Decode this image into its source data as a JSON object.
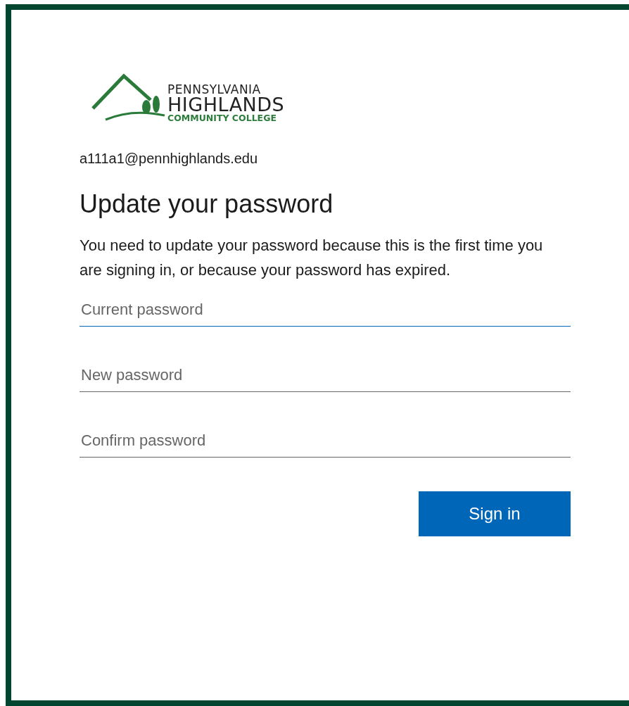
{
  "logo": {
    "line_1": "PENNSYLVANIA",
    "line_2": "HIGHLANDS",
    "line_3": "COMMUNITY COLLEGE"
  },
  "account": "a111a1@pennhighlands.edu",
  "title": "Update your password",
  "description": "You need to update your password because this is the first time you are signing in, or because your password has expired.",
  "fields": [
    {
      "placeholder": "Current password",
      "focused": true
    },
    {
      "placeholder": "New password",
      "focused": false
    },
    {
      "placeholder": "Confirm password",
      "focused": false
    }
  ],
  "submit": "Sign in"
}
